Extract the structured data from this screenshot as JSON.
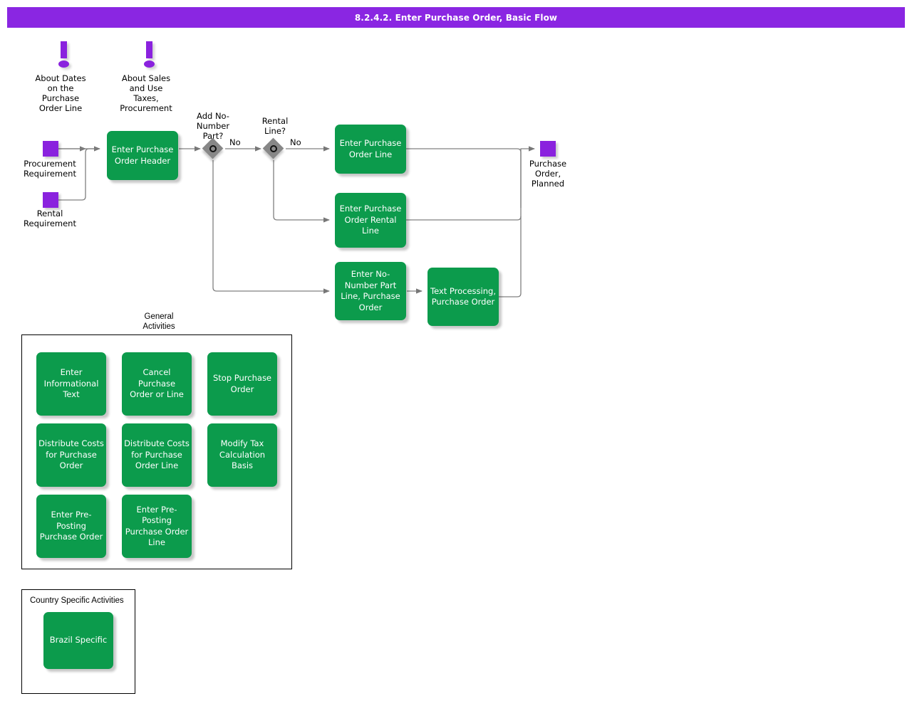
{
  "header": {
    "title": "8.2.4.2. Enter Purchase Order, Basic Flow",
    "bar_color": "#8A26E2"
  },
  "palette": {
    "process_green": "#0C9B4C",
    "terminal_purple": "#8A22DE",
    "decision_gray": "#878787",
    "connector_gray": "#808080",
    "text_white": "#FFFFFF",
    "text_black": "#000000"
  },
  "notes": [
    {
      "id": "note-dates",
      "icon": "exclamation-icon",
      "label": "About Dates\non the\nPurchase\nOrder Line"
    },
    {
      "id": "note-taxes",
      "icon": "exclamation-icon",
      "label": "About Sales\nand Use\nTaxes,\nProcurement"
    }
  ],
  "terminals": [
    {
      "id": "procurement-requirement",
      "label": "Procurement\nRequirement"
    },
    {
      "id": "rental-requirement",
      "label": "Rental\nRequirement"
    },
    {
      "id": "purchase-order-planned",
      "label": "Purchase\nOrder,\nPlanned"
    }
  ],
  "decisions": [
    {
      "id": "add-no-number-part",
      "label": "Add No-\nNumber\nPart?",
      "no_label": "No"
    },
    {
      "id": "rental-line",
      "label": "Rental\nLine?",
      "no_label": "No"
    }
  ],
  "flow": {
    "enter_purchase_order_header": "Enter Purchase\nOrder Header",
    "enter_purchase_order_line": "Enter Purchase\nOrder Line",
    "enter_purchase_order_rental_line": "Enter Purchase\nOrder Rental\nLine",
    "enter_no_number_part_line": "Enter No-\nNumber Part\nLine, Purchase\nOrder",
    "text_processing_purchase_order": "Text Processing,\nPurchase Order"
  },
  "general_activities": {
    "title": "General\nActivities",
    "items": [
      {
        "id": "enter-informational-text",
        "label": "Enter\nInformational\nText"
      },
      {
        "id": "cancel-purchase-order-or-line",
        "label": "Cancel Purchase\nOrder or Line"
      },
      {
        "id": "stop-purchase-order",
        "label": "Stop Purchase\nOrder"
      },
      {
        "id": "distribute-costs-for-purchase-order",
        "label": "Distribute Costs\nfor Purchase\nOrder"
      },
      {
        "id": "distribute-costs-for-purchase-order-line",
        "label": "Distribute Costs\nfor Purchase\nOrder Line"
      },
      {
        "id": "modify-tax-calculation-basis",
        "label": "Modify Tax\nCalculation\nBasis"
      },
      {
        "id": "enter-pre-posting-purchase-order",
        "label": "Enter Pre-\nPosting\nPurchase Order"
      },
      {
        "id": "enter-pre-posting-purchase-order-line",
        "label": "Enter Pre-\nPosting\nPurchase Order\nLine"
      }
    ]
  },
  "country_specific_activities": {
    "title": "Country Specific Activities",
    "items": [
      {
        "id": "brazil-specific",
        "label": "Brazil Specific"
      }
    ]
  }
}
